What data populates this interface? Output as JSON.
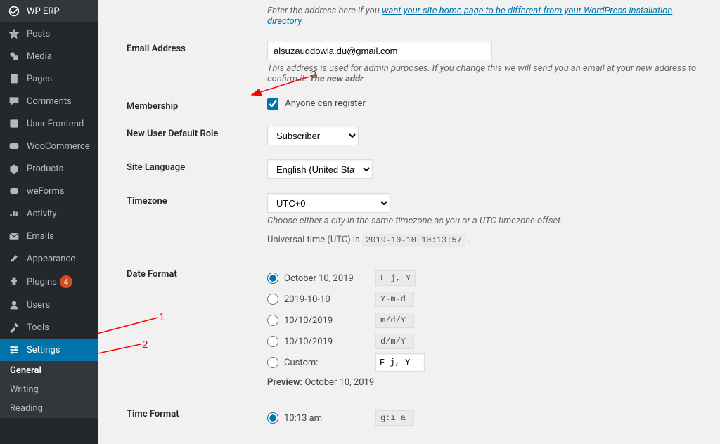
{
  "sidebar": {
    "items": [
      {
        "label": "WP ERP"
      },
      {
        "label": "Posts"
      },
      {
        "label": "Media"
      },
      {
        "label": "Pages"
      },
      {
        "label": "Comments"
      },
      {
        "label": "User Frontend"
      },
      {
        "label": "WooCommerce"
      },
      {
        "label": "Products"
      },
      {
        "label": "weForms"
      },
      {
        "label": "Activity"
      },
      {
        "label": "Emails"
      },
      {
        "label": "Appearance"
      },
      {
        "label": "Plugins",
        "badge": "4"
      },
      {
        "label": "Users"
      },
      {
        "label": "Tools"
      },
      {
        "label": "Settings"
      }
    ],
    "sub": [
      "General",
      "Writing",
      "Reading"
    ]
  },
  "address_hint_prefix": "Enter the address here if you ",
  "address_hint_link": "want your site home page to be different from your WordPress installation directory",
  "address_hint_suffix": ".",
  "email": {
    "label": "Email Address",
    "value": "alsuzauddowla.du@gmail.com",
    "hint": "This address is used for admin purposes. If you change this we will send you an email at your new address to confirm it. ",
    "hint_bold": "The new addr"
  },
  "membership": {
    "label": "Membership",
    "checkbox_label": "Anyone can register"
  },
  "default_role": {
    "label": "New User Default Role",
    "value": "Subscriber"
  },
  "language": {
    "label": "Site Language",
    "value": "English (United States)"
  },
  "timezone": {
    "label": "Timezone",
    "value": "UTC+0",
    "hint": "Choose either a city in the same timezone as you or a UTC timezone offset.",
    "utc_prefix": "Universal time (UTC) is ",
    "utc_value": "2019-10-10 10:13:57",
    "utc_suffix": " ."
  },
  "date_format": {
    "label": "Date Format",
    "options": [
      {
        "label": "October 10, 2019",
        "code": "F j, Y"
      },
      {
        "label": "2019-10-10",
        "code": "Y-m-d"
      },
      {
        "label": "10/10/2019",
        "code": "m/d/Y"
      },
      {
        "label": "10/10/2019",
        "code": "d/m/Y"
      }
    ],
    "custom_label": "Custom:",
    "custom_value": "F j, Y",
    "preview_label": "Preview:",
    "preview_value": "October 10, 2019"
  },
  "time_format": {
    "label": "Time Format",
    "option_label": "10:13 am",
    "option_code": "g:i a"
  },
  "anno": {
    "1": "1",
    "2": "2",
    "3": "3"
  }
}
